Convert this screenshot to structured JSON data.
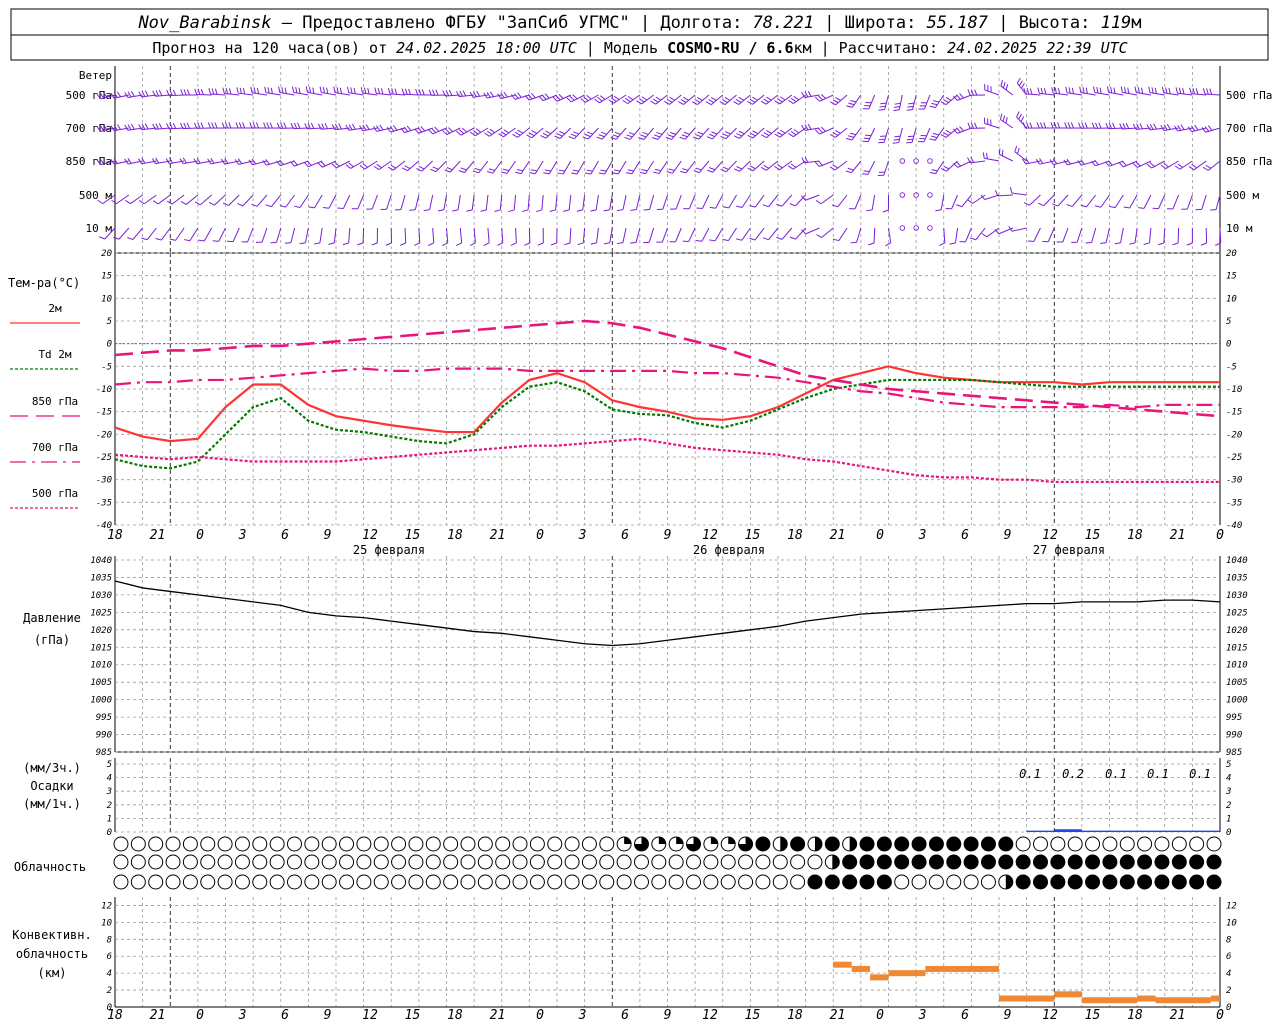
{
  "header": {
    "station": "Nov_Barabinsk",
    "provider": " — Предоставлено ФГБУ \"ЗапСиб УГМС\" | Долгота: ",
    "lon": "78.221",
    "lat_label": " | Широта: ",
    "lat": "55.187",
    "alt_label": " | Высота: ",
    "alt": "119",
    "alt_unit": "м",
    "line2_a": "Прогноз на 120 часа(ов) от ",
    "forecast_from": "24.02.2025 18:00 UTC",
    "line2_b": " | Модель ",
    "model": "COSMO-RU / 6.6",
    "model_unit": "км",
    "line2_c": " | Рассчитано: ",
    "computed": "24.02.2025 22:39 UTC"
  },
  "wind_panel": {
    "title": "Ветер",
    "levels": [
      "500 гПа",
      "700 гПа",
      "850 гПа",
      "500 м",
      "10  м"
    ],
    "color": "#7a1fd6"
  },
  "temp_panel": {
    "title": "Тем-ра(°С)",
    "yticks": [
      "20",
      "15",
      "10",
      "5",
      "0",
      "-5",
      "-10",
      "-15",
      "-20",
      "-25",
      "-30",
      "-35",
      "-40"
    ],
    "legend": [
      {
        "label": "2м",
        "color": "#ff3333",
        "style": "solid"
      },
      {
        "label": "Td  2м",
        "color": "#007a00",
        "style": "dotted"
      },
      {
        "label": "850 гПа",
        "color": "#e8157a",
        "style": "dash"
      },
      {
        "label": "700 гПа",
        "color": "#e8157a",
        "style": "dashdot"
      },
      {
        "label": "500 гПа",
        "color": "#e8157a",
        "style": "dot"
      }
    ]
  },
  "time_axis": {
    "hour_labels": [
      "18",
      "21",
      "0",
      "3",
      "6",
      "9",
      "12",
      "15",
      "18",
      "21",
      "0",
      "3",
      "6",
      "9",
      "12",
      "15",
      "18",
      "21",
      "0",
      "3",
      "6",
      "9",
      "12",
      "15",
      "18",
      "21",
      "0"
    ],
    "dates": [
      "25 февраля",
      "26 февраля",
      "27 февраля"
    ]
  },
  "pressure_panel": {
    "title": "Давление",
    "unit": "(гПа)",
    "yticks": [
      "1040",
      "1035",
      "1030",
      "1025",
      "1020",
      "1015",
      "1010",
      "1005",
      "1000",
      "995",
      "990",
      "985"
    ]
  },
  "precip_panel": {
    "unit_top": "(мм/3ч.)",
    "title": "Осадки",
    "unit_bottom": "(мм/1ч.)",
    "yticks": [
      "5",
      "4",
      "3",
      "2",
      "1",
      "0"
    ],
    "amount_labels": [
      "0.1",
      "0.2",
      "0.1",
      "0.1",
      "0.1"
    ]
  },
  "cloud_panel": {
    "title": "Облачность"
  },
  "conv_panel": {
    "title_1": "Конвективн.",
    "title_2": "облачность",
    "unit": "(км)",
    "yticks": [
      "12",
      "10",
      "8",
      "6",
      "4",
      "2",
      "0"
    ]
  },
  "chart_data": [
    {
      "type": "line",
      "name": "temperature",
      "x_hours": [
        0,
        3,
        6,
        9,
        12,
        15,
        18,
        21,
        24,
        27,
        30,
        33,
        36,
        39,
        42,
        45,
        48,
        51,
        54,
        57,
        60,
        63,
        66,
        69,
        72,
        75,
        78,
        81,
        84,
        87,
        90,
        93,
        96,
        99,
        102,
        105,
        108,
        111,
        114,
        117,
        120
      ],
      "ylim": [
        -40,
        20
      ],
      "series": [
        {
          "name": "2м",
          "values": [
            -18.5,
            -20.5,
            -21.5,
            -21,
            -14,
            -9,
            -9,
            -13.5,
            -16,
            -17,
            -18,
            -18.8,
            -19.5,
            -19.5,
            -13,
            -8,
            -6.5,
            -8.5,
            -12.5,
            -14,
            -15,
            -16.5,
            -16.8,
            -16,
            -14,
            -11,
            -8,
            -6.5,
            -5,
            -6.5,
            -7.5,
            -8,
            -8.5,
            -8.5,
            -8.5,
            -9,
            -8.5,
            -8.5,
            -8.5,
            -8.5,
            -8.5
          ]
        },
        {
          "name": "Td  2м",
          "values": [
            -25.5,
            -27,
            -27.5,
            -26,
            -20,
            -14,
            -12,
            -17,
            -19,
            -19.5,
            -20.5,
            -21.5,
            -22,
            -20,
            -14,
            -9.5,
            -8.5,
            -10.5,
            -14.5,
            -15.5,
            -15.8,
            -17.5,
            -18.5,
            -17,
            -14.5,
            -12,
            -10,
            -9,
            -8,
            -8,
            -8,
            -8,
            -8.5,
            -9,
            -9.5,
            -9.5,
            -9.5,
            -9.5,
            -9.5,
            -9.5,
            -9.5
          ]
        },
        {
          "name": "850 гПа",
          "values": [
            -2.5,
            -2,
            -1.5,
            -1.5,
            -1,
            -0.5,
            -0.5,
            0,
            0.5,
            1,
            1.5,
            2,
            2.5,
            3,
            3.5,
            4,
            4.5,
            5,
            4.5,
            3.5,
            2,
            0.5,
            -1,
            -3,
            -5,
            -7,
            -8,
            -9,
            -10,
            -10.5,
            -11,
            -11.5,
            -12,
            -12.5,
            -13,
            -13.5,
            -14,
            -14.5,
            -15,
            -15.5,
            -16
          ]
        },
        {
          "name": "700 гПа",
          "values": [
            -9,
            -8.5,
            -8.5,
            -8,
            -8,
            -7.5,
            -7,
            -6.5,
            -6,
            -5.5,
            -6,
            -6,
            -5.5,
            -5.5,
            -5.5,
            -6,
            -6,
            -6,
            -6,
            -6,
            -6,
            -6.5,
            -6.5,
            -7,
            -7.5,
            -8.5,
            -9.5,
            -10.5,
            -11,
            -12,
            -13,
            -13.5,
            -14,
            -14,
            -14,
            -14,
            -13.5,
            -14,
            -13.5,
            -13.5,
            -13.5
          ]
        },
        {
          "name": "500 гПа",
          "values": [
            -24.5,
            -25,
            -25.5,
            -25,
            -25.5,
            -26,
            -26,
            -26,
            -26,
            -25.5,
            -25,
            -24.5,
            -24,
            -23.5,
            -23,
            -22.5,
            -22.5,
            -22,
            -21.5,
            -21,
            -22,
            -23,
            -23.5,
            -24,
            -24.5,
            -25.5,
            -26,
            -27,
            -28,
            -29,
            -29.5,
            -29.5,
            -30,
            -30,
            -30.5,
            -30.5,
            -30.5,
            -30.5,
            -30.5,
            -30.5,
            -30.5
          ]
        }
      ]
    },
    {
      "type": "line",
      "name": "pressure",
      "x_hours": [
        0,
        3,
        6,
        9,
        12,
        15,
        18,
        21,
        24,
        27,
        30,
        33,
        36,
        39,
        42,
        45,
        48,
        51,
        54,
        57,
        60,
        63,
        66,
        69,
        72,
        75,
        78,
        81,
        84,
        87,
        90,
        93,
        96,
        99,
        102,
        105,
        108,
        111,
        114,
        117,
        120
      ],
      "ylim": [
        985,
        1040
      ],
      "values": [
        1034,
        1032,
        1031,
        1030,
        1029,
        1028,
        1027,
        1025,
        1024,
        1023.5,
        1022.5,
        1021.5,
        1020.5,
        1019.5,
        1019,
        1018,
        1017,
        1016,
        1015.5,
        1016,
        1017,
        1018,
        1019,
        1020,
        1021,
        1022.5,
        1023.5,
        1024.5,
        1025,
        1025.5,
        1026,
        1026.5,
        1027,
        1027.5,
        1027.5,
        1028,
        1028,
        1028,
        1028.5,
        1028.5,
        1028
      ]
    },
    {
      "type": "bar",
      "name": "precipitation",
      "ylim": [
        0,
        5
      ],
      "x_hours": [
        99,
        102,
        105,
        108,
        111,
        114,
        117
      ],
      "values": [
        0.1,
        0.2,
        0.1,
        0.1,
        0.1,
        0.1,
        0.1
      ]
    },
    {
      "type": "bar",
      "name": "convective_cloud_base_km",
      "ylim": [
        0,
        12
      ],
      "segments": [
        {
          "from": 78,
          "to": 80,
          "value": 5
        },
        {
          "from": 80,
          "to": 82,
          "value": 4.5
        },
        {
          "from": 82,
          "to": 84,
          "value": 3.5
        },
        {
          "from": 84,
          "to": 86,
          "value": 4
        },
        {
          "from": 86,
          "to": 88,
          "value": 4
        },
        {
          "from": 88,
          "to": 96,
          "value": 4.5
        },
        {
          "from": 96,
          "to": 102,
          "value": 1
        },
        {
          "from": 102,
          "to": 105,
          "value": 1.5
        },
        {
          "from": 105,
          "to": 111,
          "value": 0.8
        },
        {
          "from": 111,
          "to": 113,
          "value": 1
        },
        {
          "from": 113,
          "to": 119,
          "value": 0.8
        },
        {
          "from": 119,
          "to": 120,
          "value": 1
        }
      ]
    }
  ]
}
